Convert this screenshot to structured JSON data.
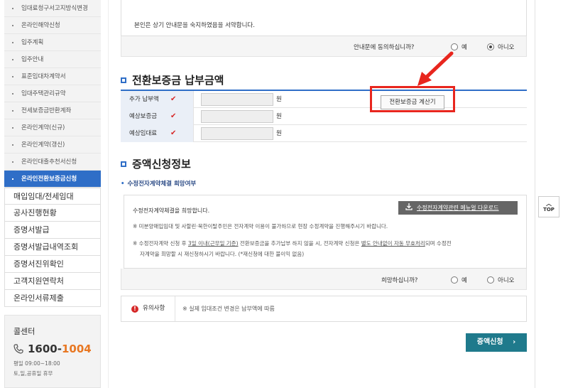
{
  "sidebar": {
    "sub_items": [
      {
        "label": "임대료청구서고지방식변경"
      },
      {
        "label": "온라인해약신청"
      },
      {
        "label": "입주계획"
      },
      {
        "label": "입주안내"
      },
      {
        "label": "표준임대차계약서"
      },
      {
        "label": "임대주택관리규약"
      },
      {
        "label": "전세보증금반환계좌"
      },
      {
        "label": "온라인계약(신규)"
      },
      {
        "label": "온라인계약(갱신)"
      },
      {
        "label": "온라인대출추천서신청"
      },
      {
        "label": "온라인전환보증금신청",
        "active": true
      }
    ],
    "main_items": [
      {
        "label": "매입임대/전세임대"
      },
      {
        "label": "공사진행현황"
      },
      {
        "label": "증명서발급"
      },
      {
        "label": "증명서발급내역조회"
      },
      {
        "label": "증명서진위확인"
      },
      {
        "label": "고객지원연락처"
      },
      {
        "label": "온라인서류제출"
      }
    ],
    "callcenter": {
      "title": "콜센터",
      "phone_prefix": "1600-",
      "phone_suffix": "1004",
      "hours_weekday": "평일 09:00~18:00",
      "hours_weekend": "토,일,공휴일 휴무",
      "icon": "phone-icon"
    }
  },
  "agreement": {
    "text": "본인은 상기 안내문을 숙지하였음을 서약합니다.",
    "question": "안내문에 동의하십니까?",
    "yes": "예",
    "no": "아니오",
    "selected": "no"
  },
  "payment": {
    "title": "전환보증금 납부금액",
    "rows": [
      {
        "label": "추가 납부액",
        "unit": "원",
        "value": ""
      },
      {
        "label": "예상보증금",
        "unit": "원",
        "value": ""
      },
      {
        "label": "예상임대료",
        "unit": "원",
        "value": ""
      }
    ],
    "calc_button": "전환보증금 계산기"
  },
  "increase": {
    "title": "증액신청정보",
    "subtitle": "수정전자계약체결 희망여부",
    "line1": "수정전자계약체결을 희망합니다.",
    "manual_button": "수정전자계약관련 메뉴얼 다운로드",
    "note1": "※ 미분양매입임대 및 사할린·북한이탈주민은 전자계약 이용이 불가하므로 현장 수정계약을 진행해주시기 바랍니다.",
    "note2_a": "※ 수정전자계약 신청 후 ",
    "note2_b": "3일 이내(근무일 기준)",
    "note2_c": " 전환보증금을 추가납부 하지 않을 시, 전자계약 신청은 ",
    "note2_d": "별도 안내없이 자동 무효처리",
    "note2_e": "되며 수정전",
    "note2_f": "자계약을 희망할 시 재신청하시기 바랍니다. (*재신청에 대한 불이익 없음)",
    "question": "희망하십니까?",
    "yes": "예",
    "no": "아니오"
  },
  "caution": {
    "head": "유의사항",
    "text": "※ 실제 임대조건 변경은 납부액에 따름"
  },
  "apply_button": "증액신청",
  "top_button": "TOP",
  "colors": {
    "accent_blue": "#2f6ec7",
    "highlight_red": "#e8261e",
    "apply_teal": "#1f7a8c",
    "phone_orange": "#e87722"
  }
}
